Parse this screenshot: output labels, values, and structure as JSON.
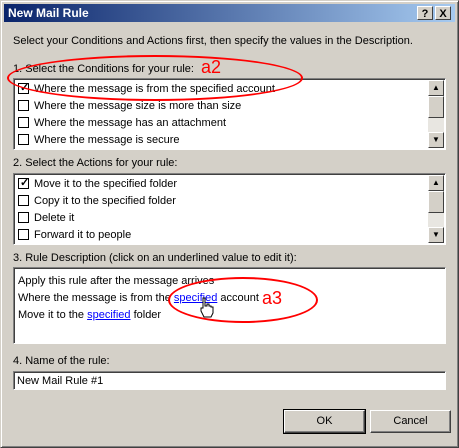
{
  "window": {
    "title": "New Mail Rule",
    "help_button": "?",
    "close_button": "X"
  },
  "intro_text": "Select your Conditions and Actions first, then specify the values in the Description.",
  "conditions": {
    "label": "1. Select the Conditions for your rule:",
    "items": [
      {
        "text": "Where the message is from the specified account",
        "checked": true
      },
      {
        "text": "Where the message size is more than size",
        "checked": false
      },
      {
        "text": "Where the message has an attachment",
        "checked": false
      },
      {
        "text": "Where the message is secure",
        "checked": false
      }
    ]
  },
  "actions": {
    "label": "2. Select the Actions for your rule:",
    "items": [
      {
        "text": "Move it to the specified folder",
        "checked": true
      },
      {
        "text": "Copy it to the specified folder",
        "checked": false
      },
      {
        "text": "Delete it",
        "checked": false
      },
      {
        "text": "Forward it to people",
        "checked": false
      }
    ]
  },
  "description": {
    "label": "3. Rule Description (click on an underlined value to edit it):",
    "line1": "Apply this rule after the message arrives",
    "line2_before": "Where the message is from the ",
    "line2_link": "specified",
    "line2_after": " account",
    "line3_before": "Move it to the ",
    "line3_link": "specified",
    "line3_after": " folder"
  },
  "name": {
    "label": "4. Name of the rule:",
    "value": "New Mail Rule #1"
  },
  "buttons": {
    "ok": "OK",
    "cancel": "Cancel"
  },
  "annotations": {
    "a2": "a2",
    "a3": "a3",
    "color": "#ff0000"
  }
}
